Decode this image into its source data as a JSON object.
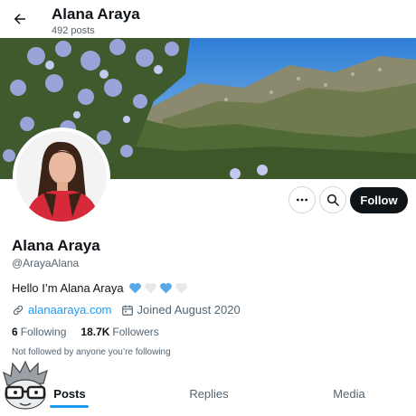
{
  "header": {
    "name": "Alana Araya",
    "post_count": "492 posts"
  },
  "profile": {
    "name": "Alana Araya",
    "handle": "@ArayaAlana",
    "bio_text": "Hello I’m Alana Araya",
    "bio_hearts": [
      "blue",
      "white",
      "blue",
      "white"
    ],
    "website": "alanaaraya.com",
    "joined": "Joined August 2020",
    "following_count": "6",
    "following_label": "Following",
    "followers_count": "18.7K",
    "followers_label": "Followers",
    "mutual_note": "Not followed by anyone you’re following"
  },
  "actions": {
    "more_icon": "more-horizontal-icon",
    "search_icon": "search-icon",
    "follow_label": "Follow"
  },
  "tabs": [
    {
      "label": "Posts",
      "active": true
    },
    {
      "label": "Replies",
      "active": false
    },
    {
      "label": "Media",
      "active": false
    }
  ],
  "colors": {
    "accent": "#1d9bf0",
    "text": "#0f1419",
    "muted": "#536471",
    "follow_bg": "#0f1419",
    "heart_blue": "#5aa9e6",
    "heart_white": "#e8e8e8"
  }
}
